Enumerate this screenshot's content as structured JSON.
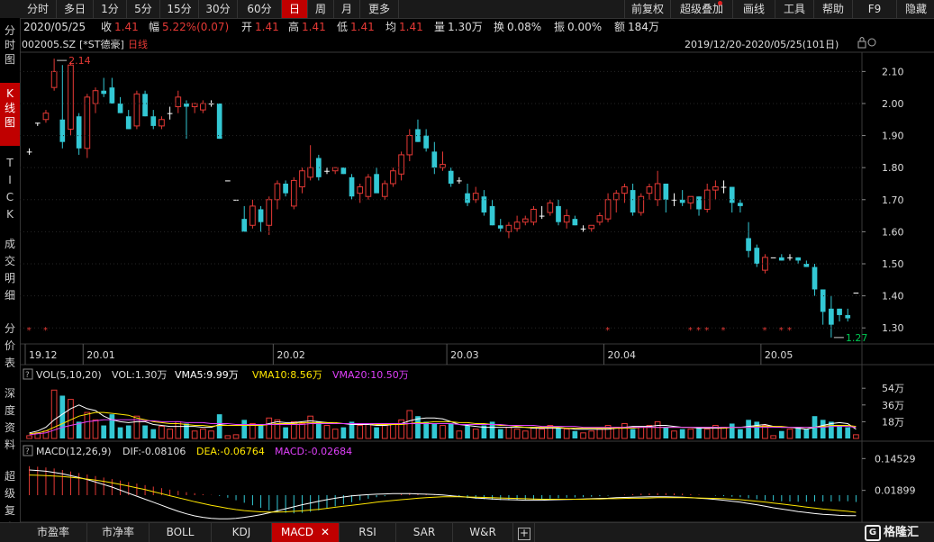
{
  "colors": {
    "up": "#e53935",
    "down": "#33c8d4",
    "yellow": "#ffe600",
    "magenta": "#e040fb",
    "white": "#ffffff",
    "green": "#00c853",
    "red_accent": "#c00000"
  },
  "toolbar": {
    "periods": [
      "分时",
      "多日",
      "1分",
      "5分",
      "15分",
      "30分",
      "60分",
      "日",
      "周",
      "月",
      "更多"
    ],
    "active_period": "日",
    "tools": [
      "前复权",
      "超级叠加",
      "画线",
      "工具",
      "帮助",
      "F9",
      "隐藏"
    ]
  },
  "quote": {
    "date": "2020/05/25",
    "close_label": "收",
    "close": "1.41",
    "change_label": "幅",
    "change": "5.22%(0.07)",
    "open_label": "开",
    "open": "1.41",
    "high_label": "高",
    "high": "1.41",
    "low_label": "低",
    "low": "1.41",
    "avg_label": "均",
    "avg": "1.41",
    "volume_label": "量",
    "volume": "1.30万",
    "turnover_label": "换",
    "turnover": "0.08%",
    "amplitude_label": "振",
    "amplitude": "0.00%",
    "amount_label": "额",
    "amount": "184万"
  },
  "sidebar": [
    "分时图",
    "K线图",
    "TICK",
    "成交明细",
    "分价表",
    "深度资料",
    "超级复盘"
  ],
  "sidebar_active": 1,
  "kline": {
    "code": "002005.SZ",
    "name": "[*ST德豪]",
    "period": "日线",
    "range": "2019/12/20-2020/05/25(101日)",
    "y_ticks": [
      "2.10",
      "2.00",
      "1.90",
      "1.80",
      "1.70",
      "1.60",
      "1.50",
      "1.40",
      "1.30"
    ],
    "x_labels": [
      "19.12",
      "20.01",
      "20.02",
      "20.03",
      "20.04",
      "20.05"
    ],
    "max_label": "2.14",
    "min_label": "1.27"
  },
  "vol": {
    "name": "VOL(5,10,20)",
    "vol": "VOL:1.30万",
    "vma5": "VMA5:9.99万",
    "vma10": "VMA10:8.56万",
    "vma20": "VMA20:10.50万",
    "y_ticks": [
      "54万",
      "36万",
      "18万"
    ]
  },
  "macd": {
    "name": "MACD(12,26,9)",
    "dif": "DIF:-0.08106",
    "dea": "DEA:-0.06764",
    "macd": "MACD:-0.02684",
    "y_ticks": [
      "0.14529",
      "0.01899"
    ]
  },
  "bottom_tabs": [
    "市盈率",
    "市净率",
    "BOLL",
    "KDJ",
    "MACD",
    "RSI",
    "SAR",
    "W&R"
  ],
  "bottom_active": "MACD",
  "brand": "格隆汇",
  "chart_data": {
    "type": "candlestick",
    "ylim": [
      1.25,
      2.16
    ],
    "candles": [
      [
        1.85,
        1.86,
        1.84,
        1.85
      ],
      [
        1.94,
        1.94,
        1.93,
        1.94
      ],
      [
        1.95,
        1.98,
        1.94,
        1.97
      ],
      [
        2.05,
        2.14,
        2.04,
        2.1
      ],
      [
        1.95,
        2.12,
        1.86,
        1.88
      ],
      [
        1.92,
        2.13,
        1.9,
        2.12
      ],
      [
        1.96,
        1.97,
        1.84,
        1.86
      ],
      [
        1.86,
        2.03,
        1.83,
        2.02
      ],
      [
        2.0,
        2.05,
        1.97,
        2.04
      ],
      [
        2.04,
        2.08,
        2.02,
        2.03
      ],
      [
        2.05,
        2.08,
        2.0,
        2.0
      ],
      [
        2.0,
        2.02,
        1.97,
        1.97
      ],
      [
        1.96,
        1.98,
        1.92,
        1.92
      ],
      [
        1.93,
        2.04,
        1.92,
        2.03
      ],
      [
        2.03,
        2.04,
        1.96,
        1.96
      ],
      [
        1.96,
        1.98,
        1.92,
        1.93
      ],
      [
        1.93,
        1.96,
        1.92,
        1.95
      ],
      [
        1.97,
        1.99,
        1.95,
        1.97
      ],
      [
        1.99,
        2.04,
        1.97,
        2.02
      ],
      [
        2.0,
        2.01,
        1.89,
        1.99
      ],
      [
        1.99,
        2.0,
        1.97,
        2.0
      ],
      [
        1.98,
        2.01,
        1.97,
        2.0
      ],
      [
        2.0,
        2.01,
        1.99,
        2.0
      ],
      [
        2.0,
        2.0,
        1.89,
        1.89
      ],
      [
        1.76,
        1.76,
        1.76,
        1.76
      ],
      [
        1.7,
        1.7,
        1.7,
        1.7
      ],
      [
        1.64,
        1.68,
        1.63,
        1.6
      ],
      [
        1.62,
        1.7,
        1.61,
        1.68
      ],
      [
        1.67,
        1.68,
        1.6,
        1.63
      ],
      [
        1.62,
        1.71,
        1.59,
        1.7
      ],
      [
        1.7,
        1.76,
        1.67,
        1.75
      ],
      [
        1.75,
        1.76,
        1.71,
        1.72
      ],
      [
        1.68,
        1.77,
        1.67,
        1.76
      ],
      [
        1.74,
        1.8,
        1.72,
        1.79
      ],
      [
        1.77,
        1.87,
        1.76,
        1.8
      ],
      [
        1.83,
        1.84,
        1.76,
        1.77
      ],
      [
        1.79,
        1.8,
        1.78,
        1.79
      ],
      [
        1.79,
        1.8,
        1.78,
        1.8
      ],
      [
        1.8,
        1.8,
        1.78,
        1.78
      ],
      [
        1.77,
        1.78,
        1.7,
        1.71
      ],
      [
        1.72,
        1.75,
        1.69,
        1.74
      ],
      [
        1.71,
        1.78,
        1.7,
        1.77
      ],
      [
        1.78,
        1.8,
        1.76,
        1.72
      ],
      [
        1.71,
        1.76,
        1.7,
        1.75
      ],
      [
        1.75,
        1.8,
        1.74,
        1.79
      ],
      [
        1.78,
        1.85,
        1.76,
        1.84
      ],
      [
        1.84,
        1.92,
        1.82,
        1.9
      ],
      [
        1.92,
        1.95,
        1.88,
        1.88
      ],
      [
        1.9,
        1.92,
        1.85,
        1.86
      ],
      [
        1.85,
        1.88,
        1.78,
        1.8
      ],
      [
        1.8,
        1.85,
        1.79,
        1.81
      ],
      [
        1.79,
        1.8,
        1.74,
        1.75
      ],
      [
        1.76,
        1.77,
        1.75,
        1.76
      ],
      [
        1.72,
        1.75,
        1.68,
        1.69
      ],
      [
        1.7,
        1.74,
        1.69,
        1.72
      ],
      [
        1.71,
        1.73,
        1.65,
        1.66
      ],
      [
        1.68,
        1.7,
        1.62,
        1.62
      ],
      [
        1.62,
        1.64,
        1.6,
        1.61
      ],
      [
        1.6,
        1.63,
        1.58,
        1.62
      ],
      [
        1.61,
        1.65,
        1.6,
        1.63
      ],
      [
        1.63,
        1.65,
        1.62,
        1.64
      ],
      [
        1.63,
        1.68,
        1.62,
        1.67
      ],
      [
        1.65,
        1.68,
        1.64,
        1.65
      ],
      [
        1.66,
        1.7,
        1.65,
        1.69
      ],
      [
        1.68,
        1.7,
        1.62,
        1.63
      ],
      [
        1.63,
        1.67,
        1.61,
        1.65
      ],
      [
        1.64,
        1.65,
        1.62,
        1.62
      ],
      [
        1.61,
        1.62,
        1.6,
        1.61
      ],
      [
        1.61,
        1.62,
        1.6,
        1.62
      ],
      [
        1.63,
        1.66,
        1.62,
        1.65
      ],
      [
        1.64,
        1.72,
        1.63,
        1.7
      ],
      [
        1.7,
        1.73,
        1.66,
        1.72
      ],
      [
        1.72,
        1.75,
        1.69,
        1.74
      ],
      [
        1.73,
        1.75,
        1.65,
        1.66
      ],
      [
        1.66,
        1.72,
        1.65,
        1.71
      ],
      [
        1.72,
        1.75,
        1.7,
        1.74
      ],
      [
        1.7,
        1.79,
        1.68,
        1.75
      ],
      [
        1.75,
        1.75,
        1.66,
        1.7
      ],
      [
        1.7,
        1.72,
        1.68,
        1.7
      ],
      [
        1.7,
        1.73,
        1.68,
        1.69
      ],
      [
        1.69,
        1.71,
        1.67,
        1.71
      ],
      [
        1.71,
        1.71,
        1.65,
        1.67
      ],
      [
        1.67,
        1.75,
        1.66,
        1.73
      ],
      [
        1.73,
        1.76,
        1.7,
        1.74
      ],
      [
        1.74,
        1.76,
        1.72,
        1.74
      ],
      [
        1.74,
        1.74,
        1.66,
        1.69
      ],
      [
        1.69,
        1.7,
        1.66,
        1.68
      ],
      [
        1.58,
        1.63,
        1.52,
        1.54
      ],
      [
        1.55,
        1.56,
        1.49,
        1.5
      ],
      [
        1.48,
        1.53,
        1.47,
        1.52
      ],
      [
        1.52,
        1.52,
        1.52,
        1.52
      ],
      [
        1.52,
        1.53,
        1.51,
        1.51
      ],
      [
        1.52,
        1.53,
        1.51,
        1.52
      ],
      [
        1.52,
        1.52,
        1.5,
        1.51
      ],
      [
        1.5,
        1.51,
        1.49,
        1.49
      ],
      [
        1.49,
        1.5,
        1.4,
        1.42
      ],
      [
        1.42,
        1.42,
        1.31,
        1.35
      ],
      [
        1.36,
        1.4,
        1.27,
        1.31
      ],
      [
        1.36,
        1.36,
        1.32,
        1.34
      ],
      [
        1.34,
        1.36,
        1.32,
        1.33
      ],
      [
        1.41,
        1.41,
        1.41,
        1.41
      ]
    ],
    "volume": [
      3,
      6,
      8,
      52,
      46,
      42,
      18,
      28,
      20,
      14,
      26,
      12,
      14,
      24,
      14,
      10,
      13,
      10,
      18,
      16,
      8,
      10,
      8,
      26,
      3,
      4,
      20,
      16,
      14,
      22,
      20,
      12,
      18,
      16,
      24,
      18,
      14,
      10,
      12,
      18,
      14,
      16,
      12,
      14,
      16,
      20,
      30,
      24,
      18,
      16,
      14,
      16,
      8,
      14,
      10,
      14,
      18,
      10,
      12,
      10,
      8,
      12,
      10,
      14,
      12,
      10,
      8,
      6,
      8,
      10,
      14,
      12,
      16,
      10,
      12,
      14,
      18,
      12,
      8,
      10,
      10,
      12,
      10,
      14,
      12,
      16,
      10,
      20,
      18,
      14,
      3,
      8,
      10,
      12,
      10,
      24,
      20,
      18,
      14,
      12,
      4
    ],
    "vma5": [
      6,
      8,
      12,
      20,
      26,
      32,
      36,
      32,
      30,
      24,
      20,
      18,
      17,
      18,
      18,
      15,
      14,
      13,
      13,
      13,
      13,
      12,
      12,
      15,
      14,
      14,
      14,
      15,
      14,
      16,
      18,
      17,
      17,
      18,
      19,
      18,
      17,
      16,
      16,
      15,
      15,
      15,
      14,
      14,
      15,
      16,
      19,
      21,
      22,
      22,
      21,
      18,
      15,
      14,
      13,
      12,
      12,
      12,
      12,
      12,
      12,
      11,
      11,
      11,
      11,
      11,
      10,
      10,
      10,
      10,
      10,
      11,
      12,
      13,
      13,
      13,
      14,
      14,
      13,
      12,
      12,
      11,
      11,
      11,
      11,
      12,
      12,
      13,
      14,
      15,
      13,
      12,
      12,
      11,
      10,
      12,
      14,
      16,
      17,
      16,
      10
    ],
    "vma10": [
      5,
      6,
      8,
      12,
      16,
      20,
      24,
      26,
      28,
      28,
      27,
      26,
      25,
      22,
      20,
      18,
      17,
      16,
      16,
      15,
      14,
      14,
      13,
      14,
      14,
      14,
      14,
      14,
      14,
      15,
      16,
      16,
      16,
      17,
      17,
      17,
      17,
      17,
      16,
      16,
      16,
      16,
      15,
      15,
      15,
      15,
      16,
      17,
      17,
      18,
      18,
      18,
      17,
      17,
      16,
      16,
      15,
      14,
      14,
      13,
      12,
      12,
      12,
      12,
      12,
      11,
      11,
      11,
      11,
      11,
      11,
      11,
      11,
      11,
      12,
      12,
      12,
      12,
      12,
      12,
      12,
      12,
      12,
      12,
      11,
      12,
      12,
      12,
      13,
      13,
      13,
      13,
      12,
      12,
      12,
      12,
      13,
      14,
      14,
      14,
      13
    ],
    "vma20": [
      4,
      5,
      6,
      9,
      12,
      14,
      16,
      18,
      19,
      20,
      20,
      20,
      20,
      20,
      19,
      19,
      18,
      18,
      18,
      17,
      17,
      17,
      16,
      16,
      16,
      15,
      15,
      15,
      15,
      15,
      15,
      15,
      15,
      15,
      16,
      16,
      16,
      16,
      16,
      16,
      16,
      16,
      16,
      16,
      16,
      16,
      16,
      16,
      16,
      16,
      16,
      16,
      15,
      15,
      15,
      15,
      15,
      15,
      14,
      14,
      14,
      14,
      13,
      13,
      13,
      13,
      13,
      12,
      12,
      12,
      12,
      12,
      12,
      12,
      12,
      12,
      12,
      12,
      12,
      12,
      12,
      12,
      12,
      12,
      12,
      12,
      12,
      12,
      12,
      12,
      12,
      12,
      12,
      12,
      12,
      12,
      12,
      13,
      13,
      13,
      12
    ],
    "macd_hist": [
      0.115,
      0.113,
      0.11,
      0.106,
      0.1,
      0.094,
      0.088,
      0.082,
      0.076,
      0.07,
      0.064,
      0.058,
      0.052,
      0.046,
      0.04,
      0.034,
      0.028,
      0.022,
      0.017,
      0.012,
      0.008,
      0.004,
      0.001,
      -0.003,
      -0.01,
      -0.02,
      -0.03,
      -0.04,
      -0.05,
      -0.06,
      -0.066,
      -0.07,
      -0.072,
      -0.07,
      -0.066,
      -0.06,
      -0.052,
      -0.044,
      -0.036,
      -0.028,
      -0.02,
      -0.014,
      -0.008,
      -0.004,
      0.0,
      0.004,
      0.008,
      0.006,
      0.004,
      0.002,
      0.0,
      -0.004,
      -0.008,
      -0.012,
      -0.014,
      -0.016,
      -0.018,
      -0.019,
      -0.02,
      -0.02,
      -0.019,
      -0.018,
      -0.016,
      -0.014,
      -0.012,
      -0.01,
      -0.009,
      -0.008,
      -0.006,
      -0.004,
      -0.002,
      0.0,
      0.002,
      0.004,
      0.006,
      0.007,
      0.008,
      0.008,
      0.007,
      0.006,
      0.004,
      0.002,
      0.0,
      -0.002,
      -0.004,
      -0.006,
      -0.008,
      -0.012,
      -0.016,
      -0.02,
      -0.022,
      -0.024,
      -0.025,
      -0.026,
      -0.026,
      -0.025,
      -0.025,
      -0.025,
      -0.024,
      -0.024,
      -0.027
    ],
    "dif": [
      0.1,
      0.098,
      0.095,
      0.09,
      0.085,
      0.078,
      0.07,
      0.062,
      0.052,
      0.042,
      0.032,
      0.02,
      0.008,
      -0.004,
      -0.016,
      -0.028,
      -0.04,
      -0.052,
      -0.064,
      -0.074,
      -0.082,
      -0.088,
      -0.092,
      -0.094,
      -0.094,
      -0.092,
      -0.088,
      -0.083,
      -0.077,
      -0.07,
      -0.062,
      -0.054,
      -0.046,
      -0.038,
      -0.031,
      -0.024,
      -0.018,
      -0.012,
      -0.007,
      -0.003,
      0.0,
      0.002,
      0.004,
      0.005,
      0.006,
      0.006,
      0.006,
      0.005,
      0.004,
      0.003,
      0.001,
      -0.002,
      -0.005,
      -0.008,
      -0.011,
      -0.013,
      -0.015,
      -0.017,
      -0.018,
      -0.019,
      -0.02,
      -0.02,
      -0.02,
      -0.019,
      -0.018,
      -0.017,
      -0.016,
      -0.015,
      -0.014,
      -0.013,
      -0.012,
      -0.01,
      -0.009,
      -0.008,
      -0.007,
      -0.006,
      -0.006,
      -0.006,
      -0.007,
      -0.008,
      -0.01,
      -0.012,
      -0.014,
      -0.017,
      -0.02,
      -0.024,
      -0.028,
      -0.033,
      -0.038,
      -0.044,
      -0.05,
      -0.055,
      -0.06,
      -0.065,
      -0.069,
      -0.073,
      -0.076,
      -0.078,
      -0.08,
      -0.081,
      -0.081
    ],
    "dea": [
      0.08,
      0.079,
      0.078,
      0.076,
      0.074,
      0.071,
      0.068,
      0.064,
      0.06,
      0.055,
      0.049,
      0.043,
      0.036,
      0.029,
      0.022,
      0.014,
      0.006,
      -0.002,
      -0.01,
      -0.018,
      -0.026,
      -0.033,
      -0.04,
      -0.046,
      -0.052,
      -0.057,
      -0.061,
      -0.064,
      -0.066,
      -0.067,
      -0.067,
      -0.066,
      -0.064,
      -0.062,
      -0.059,
      -0.056,
      -0.052,
      -0.048,
      -0.044,
      -0.04,
      -0.036,
      -0.032,
      -0.028,
      -0.024,
      -0.021,
      -0.018,
      -0.015,
      -0.012,
      -0.01,
      -0.008,
      -0.006,
      -0.006,
      -0.006,
      -0.007,
      -0.008,
      -0.009,
      -0.01,
      -0.011,
      -0.012,
      -0.013,
      -0.014,
      -0.015,
      -0.016,
      -0.016,
      -0.016,
      -0.016,
      -0.016,
      -0.016,
      -0.015,
      -0.015,
      -0.014,
      -0.014,
      -0.013,
      -0.012,
      -0.012,
      -0.011,
      -0.01,
      -0.01,
      -0.01,
      -0.01,
      -0.01,
      -0.011,
      -0.012,
      -0.013,
      -0.014,
      -0.016,
      -0.018,
      -0.021,
      -0.024,
      -0.027,
      -0.031,
      -0.035,
      -0.039,
      -0.043,
      -0.047,
      -0.051,
      -0.055,
      -0.058,
      -0.061,
      -0.064,
      -0.068
    ],
    "stars": [
      0,
      2,
      70,
      80,
      81,
      82,
      84,
      89,
      91,
      92
    ]
  }
}
